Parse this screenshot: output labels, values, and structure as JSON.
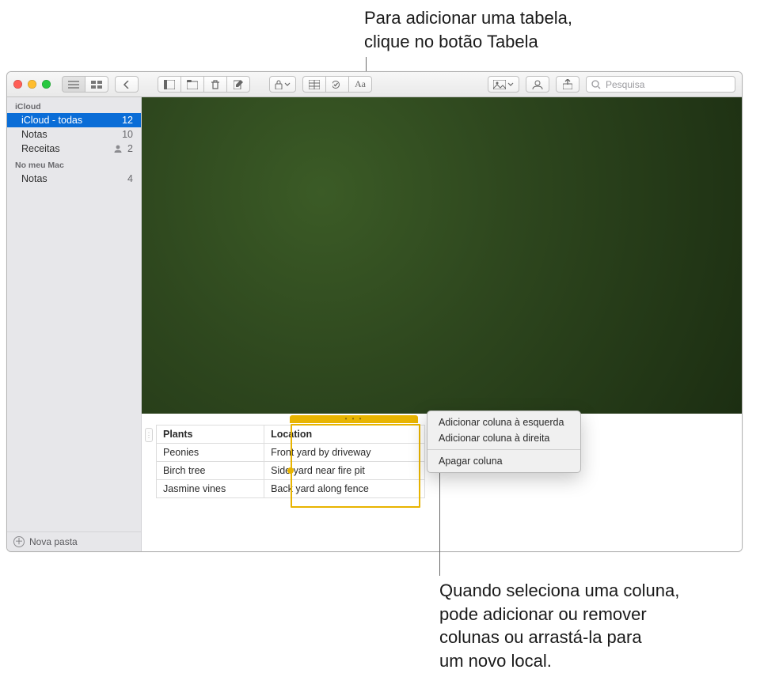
{
  "callouts": {
    "top": "Para adicionar uma tabela,\nclique no botão Tabela",
    "bottom": "Quando seleciona uma coluna,\npode adicionar ou remover\ncolunas ou arrastá-la para\num novo local."
  },
  "toolbar": {
    "search_placeholder": "Pesquisa"
  },
  "sidebar": {
    "sections": [
      {
        "title": "iCloud",
        "items": [
          {
            "label": "iCloud - todas",
            "count": "12",
            "selected": true
          },
          {
            "label": "Notas",
            "count": "10",
            "selected": false
          },
          {
            "label": "Receitas",
            "count": "2",
            "selected": false,
            "shared": true
          }
        ]
      },
      {
        "title": "No meu Mac",
        "items": [
          {
            "label": "Notas",
            "count": "4",
            "selected": false
          }
        ]
      }
    ],
    "footer": "Nova pasta"
  },
  "table": {
    "headers": [
      "Plants",
      "Location"
    ],
    "rows": [
      [
        "Peonies",
        "Front yard by driveway"
      ],
      [
        "Birch tree",
        "Side yard near fire pit"
      ],
      [
        "Jasmine vines",
        "Back yard along fence"
      ]
    ]
  },
  "context_menu": {
    "items_a": [
      "Adicionar coluna à esquerda",
      "Adicionar coluna à direita"
    ],
    "delete": "Apagar coluna"
  }
}
